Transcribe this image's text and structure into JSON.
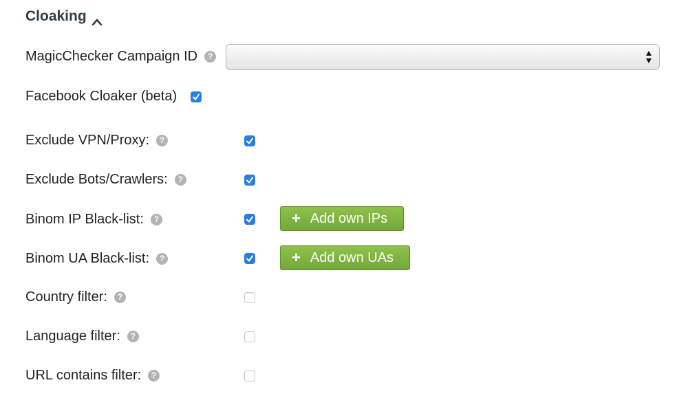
{
  "section": {
    "title": "Cloaking"
  },
  "magicchecker": {
    "label": "MagicChecker Campaign ID",
    "selected_value": ""
  },
  "facebook_cloaker": {
    "label": "Facebook Cloaker (beta)",
    "checked": true
  },
  "filters": [
    {
      "label": "Exclude VPN/Proxy:",
      "checked": true
    },
    {
      "label": "Exclude Bots/Crawlers:",
      "checked": true
    },
    {
      "label": "Binom IP Black-list:",
      "checked": true,
      "button": "Add own IPs"
    },
    {
      "label": "Binom UA Black-list:",
      "checked": true,
      "button": "Add own UAs"
    },
    {
      "label": "Country filter:",
      "checked": false
    },
    {
      "label": "Language filter:",
      "checked": false
    },
    {
      "label": "URL contains filter:",
      "checked": false
    }
  ],
  "colors": {
    "accent": "#2a7de1",
    "button_green": "#7fb544",
    "title": "#2f3e46"
  }
}
